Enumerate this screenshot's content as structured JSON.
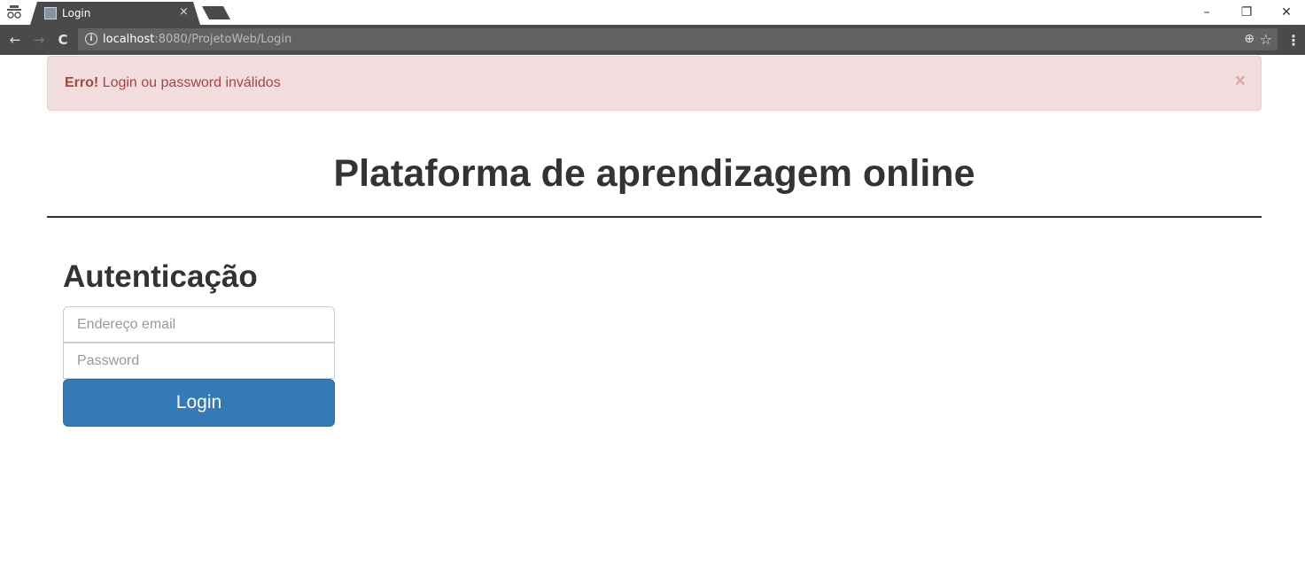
{
  "browser": {
    "tab_title": "Login",
    "tab_close": "×",
    "url_host": "localhost",
    "url_path": ":8080/ProjetoWeb/Login",
    "window_controls": {
      "minimize": "–",
      "restore": "❐",
      "close": "✕"
    },
    "nav": {
      "back": "←",
      "forward": "→",
      "reload": "C"
    },
    "icons": {
      "info": "i",
      "zoom": "⊕",
      "bookmark": "☆",
      "menu": "⋮"
    }
  },
  "alert": {
    "strong": "Erro!",
    "message": " Login ou password inválidos",
    "close": "×",
    "color": "#a94442",
    "background": "#f2dede"
  },
  "page": {
    "title": "Plataforma de aprendizagem online"
  },
  "form": {
    "heading": "Autenticação",
    "email_placeholder": "Endereço email",
    "password_placeholder": "Password",
    "submit_label": "Login",
    "button_color": "#337ab7"
  }
}
